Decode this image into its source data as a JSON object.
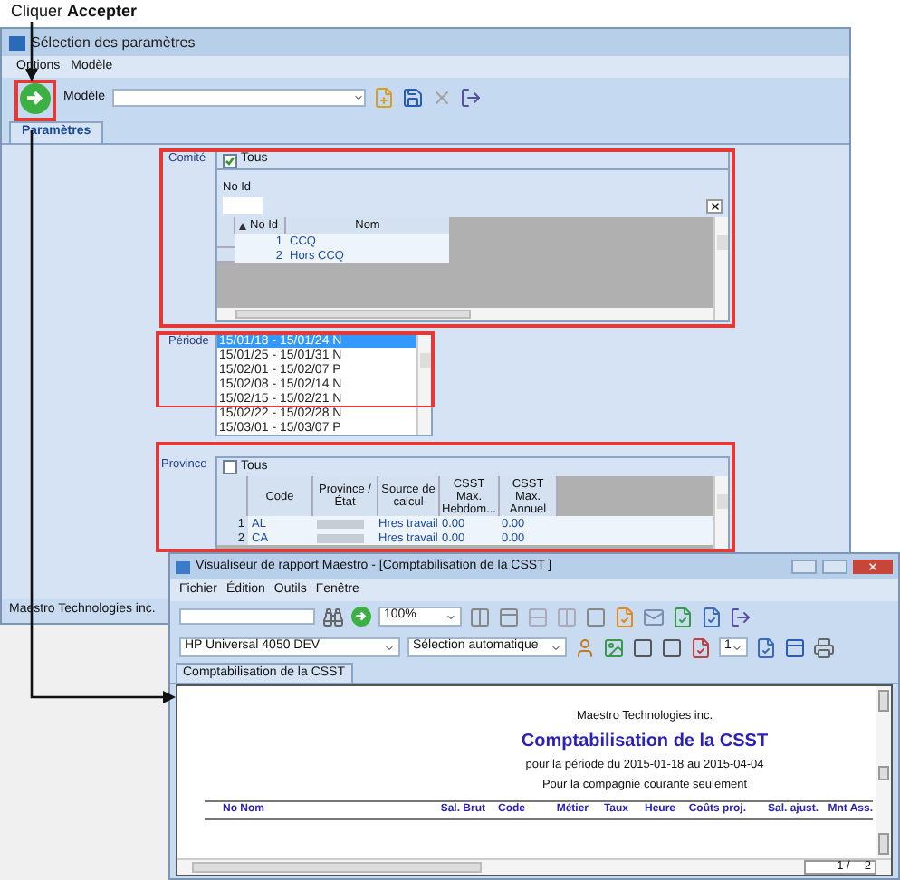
{
  "annotation": {
    "text": "Cliquer **Accepter**"
  },
  "main_window": {
    "title": "Sélection des paramètres",
    "menu": [
      "Options",
      "Modèle"
    ],
    "model_label": "Modèle",
    "tabs": [
      {
        "label": "Paramètres",
        "selected": true
      }
    ],
    "comite": {
      "label": "Comité",
      "all": {
        "label": "Tous",
        "checked": true
      },
      "filter_label": "No Id",
      "columns": [
        "No Id",
        "Nom"
      ],
      "rows": [
        {
          "no_id": "1",
          "nom": "CCQ"
        },
        {
          "no_id": "2",
          "nom": "Hors CCQ"
        }
      ]
    },
    "periode": {
      "label": "Période",
      "items": [
        {
          "text": "15/01/18 - 15/01/24 N",
          "selected": true
        },
        {
          "text": "15/01/25 - 15/01/31 N",
          "selected": false
        },
        {
          "text": "15/02/01 - 15/02/07 P",
          "selected": false
        },
        {
          "text": "15/02/08 - 15/02/14 N",
          "selected": false
        },
        {
          "text": "15/02/15 - 15/02/21 N",
          "selected": false
        },
        {
          "text": "15/02/22 - 15/02/28 N",
          "selected": false
        },
        {
          "text": "15/03/01 - 15/03/07 P",
          "selected": false
        }
      ]
    },
    "province": {
      "label": "Province",
      "all": {
        "label": "Tous",
        "checked": false
      },
      "columns": [
        "Code",
        "Province / État",
        "Source de calcul",
        "CSST Max. Hebdom...",
        "CSST Max. Annuel"
      ],
      "rows": [
        {
          "number": "1",
          "code": "AL",
          "source": "Hres travail",
          "weekly": "0.00",
          "annual": "0.00"
        },
        {
          "number": "2",
          "code": "CA",
          "source": "Hres travail",
          "weekly": "0.00",
          "annual": "0.00"
        }
      ]
    },
    "status_bar": "Maestro Technologies inc."
  },
  "report_viewer": {
    "title": "Visualiseur de rapport Maestro - [Comptabilisation de la CSST ]",
    "menu": [
      "Fichier",
      "Édition",
      "Outils",
      "Fenêtre"
    ],
    "zoom": "100%",
    "printer": "HP Universal 4050 DEV",
    "paper": "Sélection automatique",
    "copies": "1",
    "tabs": [
      {
        "label": "Comptabilisation de la CSST",
        "selected": true
      }
    ],
    "report": {
      "company": "Maestro Technologies inc.",
      "title": "Comptabilisation de la CSST",
      "period": "pour la période du 2015-01-18 au 2015-04-04",
      "scope": "Pour la compagnie courante seulement",
      "columns": [
        "No Nom",
        "Sal. Brut",
        "Code",
        "Métier",
        "Taux",
        "Heure",
        "Coûts proj.",
        "Sal. ajust.",
        "Mnt Ass."
      ]
    },
    "page": "1 /",
    "page_count": "2"
  }
}
